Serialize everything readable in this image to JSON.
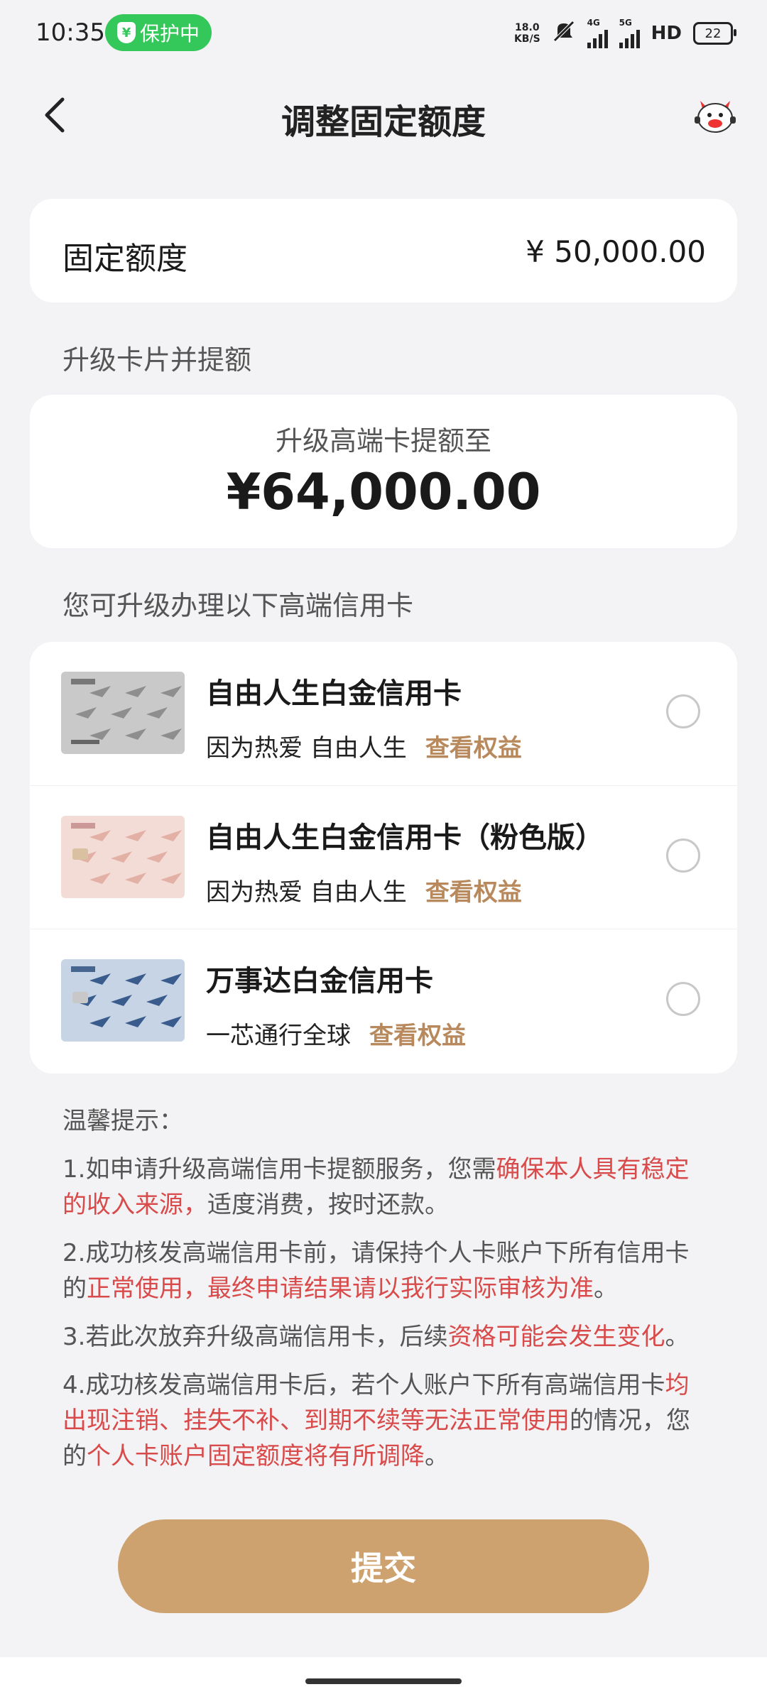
{
  "status_bar": {
    "time": "10:35",
    "protect_label": "保护中",
    "net_speed_value": "18.0",
    "net_speed_unit": "KB/S",
    "hd_label": "HD",
    "battery": "22",
    "signal_1_label": "4G",
    "signal_2_label": "5G"
  },
  "header": {
    "title": "调整固定额度"
  },
  "fixed_limit": {
    "label": "固定额度",
    "value": "¥ 50,000.00"
  },
  "upgrade_section": {
    "label": "升级卡片并提额",
    "card_title": "升级高端卡提额至",
    "amount": "¥64,000.00"
  },
  "cards_section": {
    "label": "您可升级办理以下高端信用卡",
    "items": [
      {
        "name": "自由人生白金信用卡",
        "desc": "因为热爱 自由人生",
        "benefit": "查看权益",
        "selected": false,
        "theme": "silver"
      },
      {
        "name": "自由人生白金信用卡（粉色版）",
        "desc": "因为热爱 自由人生",
        "benefit": "查看权益",
        "selected": false,
        "theme": "pink"
      },
      {
        "name": "万事达白金信用卡",
        "desc": "一芯通行全球",
        "benefit": "查看权益",
        "selected": false,
        "theme": "blue"
      }
    ]
  },
  "tips": {
    "title": "温馨提示：",
    "t1_a": "1.如申请升级高端信用卡提额服务，您需",
    "t1_b": "确保本人具有稳定的收入来源，",
    "t1_c": "适度消费，按时还款。",
    "t2_a": "2.成功核发高端信用卡前，请保持个人卡账户下所有信用卡的",
    "t2_b": "正常使用，最终申请结果请以我行实际审核为准",
    "t2_c": "。",
    "t3_a": "3.若此次放弃升级高端信用卡，后续",
    "t3_b": "资格可能会发生变化",
    "t3_c": "。",
    "t4_a": "4.成功核发高端信用卡后，若个人账户下所有高端信用卡",
    "t4_b": "均出现注销、挂失不补、到期不续等无法正常使用",
    "t4_c": "的情况，您的",
    "t4_d": "个人卡账户固定额度将有所调降",
    "t4_e": "。"
  },
  "actions": {
    "submit": "提交"
  },
  "colors": {
    "accent": "#cda26f",
    "benefit_link": "#b8895c",
    "warning_red": "#d94a4a",
    "status_green": "#34c759"
  },
  "icons": {
    "back": "chevron-left-icon",
    "mascot": "assistant-mascot-icon",
    "radio": "radio-unchecked-icon"
  }
}
